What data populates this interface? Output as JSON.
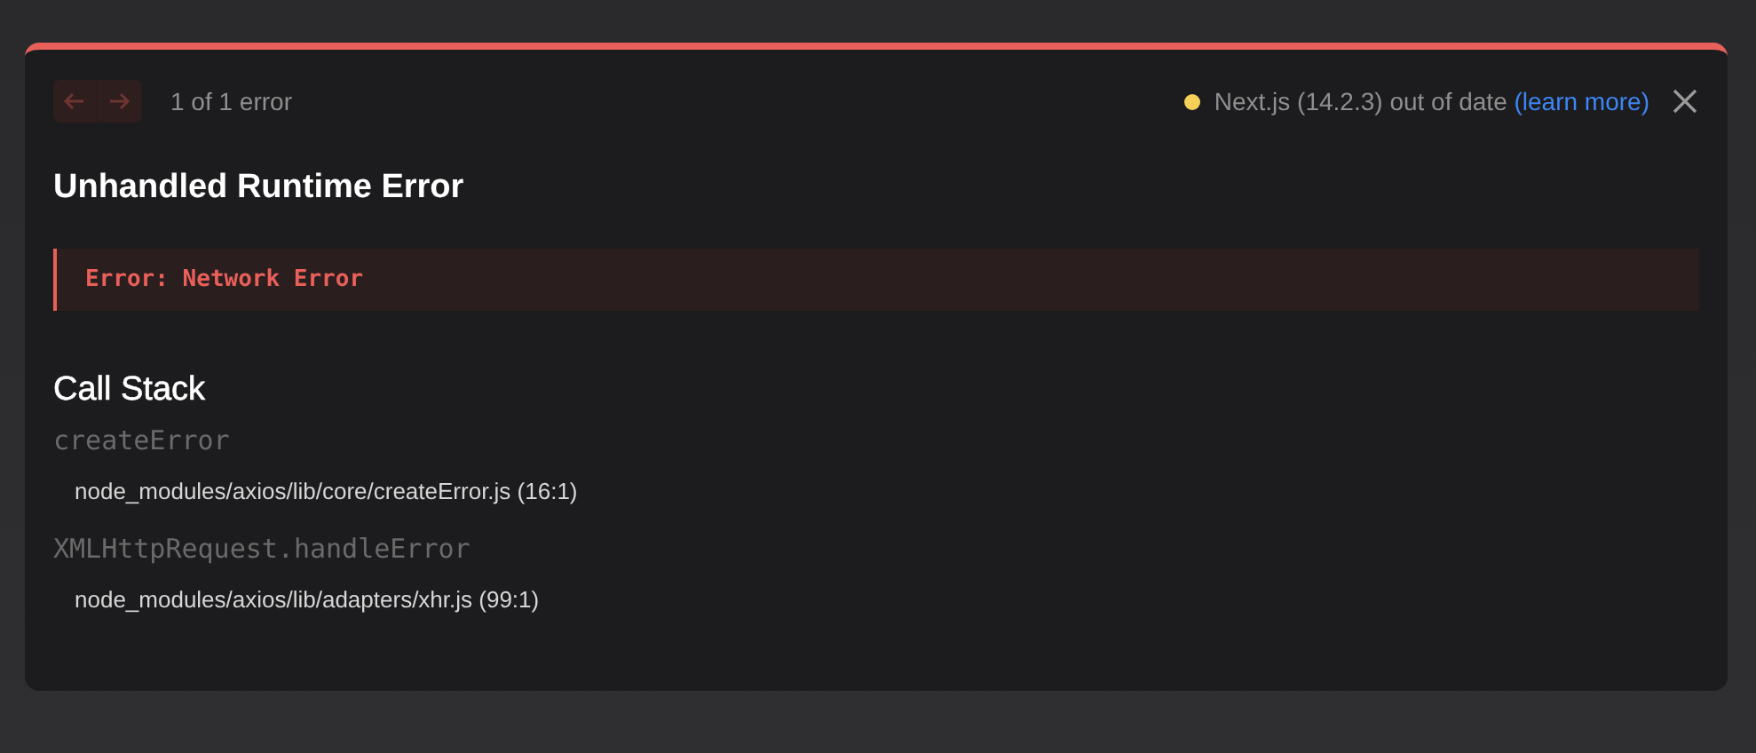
{
  "nav": {
    "buttons": [
      {
        "kind": "prev",
        "disabled": true
      },
      {
        "kind": "next",
        "disabled": true
      }
    ],
    "counter": "1 of 1 error"
  },
  "version_notice": {
    "text": "Next.js (14.2.3) out of date",
    "link": "(learn more)"
  },
  "title": "Unhandled Runtime Error",
  "error_message": "Error: Network Error",
  "call_stack": {
    "heading": "Call Stack",
    "frames": [
      {
        "function": "createError",
        "location": "node_modules/axios/lib/core/createError.js (16:1)"
      },
      {
        "function": "XMLHttpRequest.handleError",
        "location": "node_modules/axios/lib/adapters/xhr.js (99:1)"
      }
    ]
  }
}
